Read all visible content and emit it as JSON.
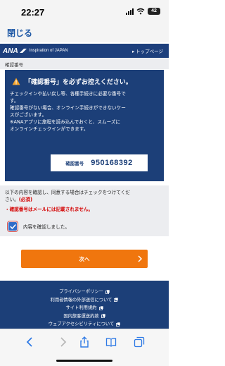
{
  "status": {
    "time": "22:27",
    "battery": "42"
  },
  "nav": {
    "close": "閉じる"
  },
  "header": {
    "logo": "ANA",
    "tagline": "Inspiration of JAPAN",
    "top_link": "▸ トップページ"
  },
  "page_label": "確認番号",
  "notice": {
    "title": "「確認番号」を必ずお控えください。",
    "lines1": [
      "チェックインや払い戻し等、各種手続きに必要な番号で",
      "す。"
    ],
    "lines2": [
      "確認番号がない場合、オンライン手続きができないケー",
      "スがございます。"
    ],
    "lines3": [
      "※ANAアプリに旅程を読み込んでおくと、スムーズに",
      "オンラインチェックインができます。"
    ],
    "confirm_label": "確認番号",
    "confirm_number": "950168392"
  },
  "check": {
    "instruction1": "以下の内容を確認し、同意する場合はチェックをつけてくだ",
    "instruction2": "さい。",
    "required": "(必須)",
    "note": "・確認番号はメールには記載されません。",
    "checkbox_label": "内容を確認しました。",
    "checked": true
  },
  "next_button": "次へ",
  "footer": {
    "links": [
      "プライバシーポリシー",
      "利用者情報の外部送信について",
      "サイト利用規約",
      "国内旅客運送約款",
      "ウェブアクセシビリティについて"
    ]
  },
  "safari": {
    "icons": [
      "back-icon",
      "forward-icon",
      "share-icon",
      "bookmarks-icon",
      "tabs-icon"
    ]
  },
  "colors": {
    "navy": "#1c3f78",
    "accent": "#f0760e",
    "link": "#1a55a4",
    "alert": "#d40000"
  }
}
